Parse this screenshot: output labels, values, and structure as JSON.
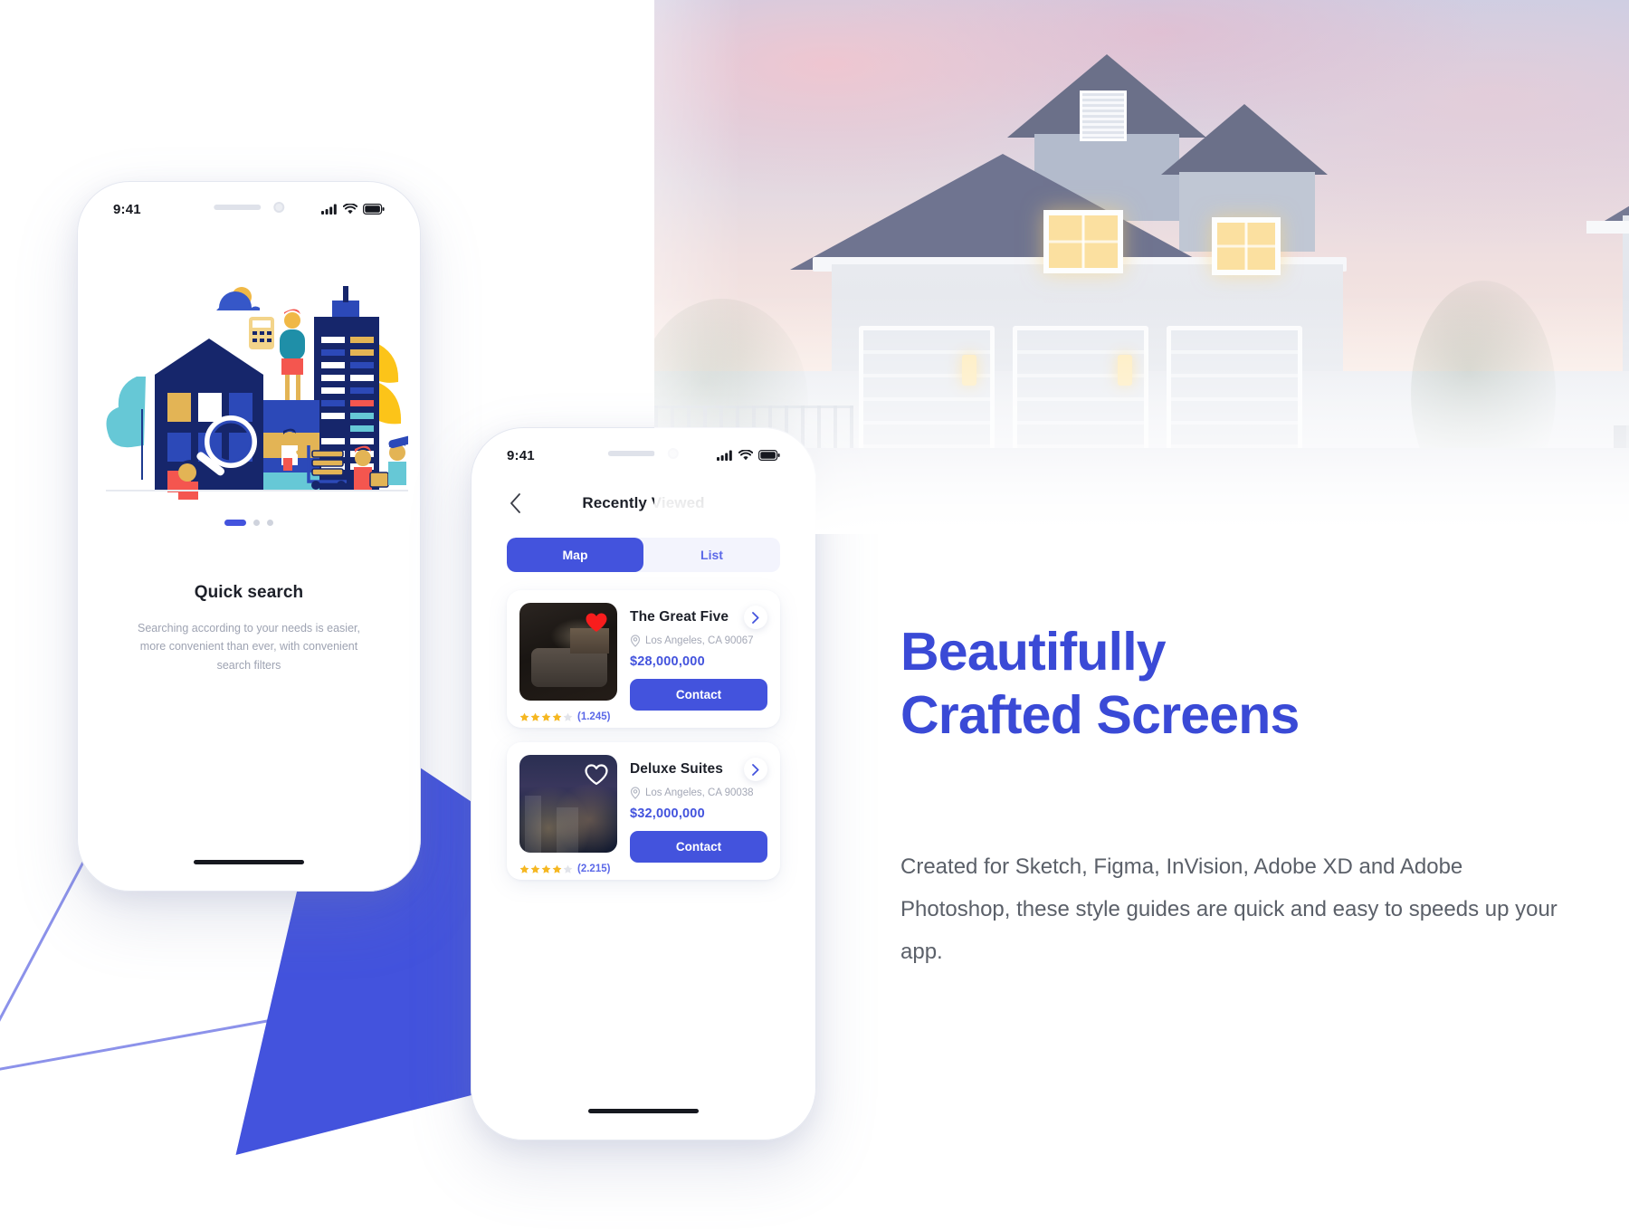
{
  "background": {
    "accent_blue": "#4353dd",
    "headline_blue": "#3a4ad6",
    "line_purple": "#8c92ea"
  },
  "phone1": {
    "status": {
      "time": "9:41",
      "signal_icon": "signal-bars-icon",
      "wifi_icon": "wifi-icon",
      "battery_icon": "battery-icon"
    },
    "illustration_name": "real-estate-search-illustration",
    "pager": {
      "dots": 3,
      "active_index": 0
    },
    "title": "Quick search",
    "description": "Searching according to your needs is easier, more convenient than ever, with convenient search filters"
  },
  "phone2": {
    "status": {
      "time": "9:41",
      "signal_icon": "signal-bars-icon",
      "wifi_icon": "wifi-icon",
      "battery_icon": "battery-icon"
    },
    "nav": {
      "back_icon": "chevron-left-icon",
      "title": "Recently Viewed"
    },
    "segments": [
      {
        "label": "Map",
        "active": true
      },
      {
        "label": "List",
        "active": false
      }
    ],
    "cards": [
      {
        "name": "The Great Five",
        "address": "Los Angeles, CA 90067",
        "price": "$28,000,000",
        "rating": 4,
        "rating_count": "(1.245)",
        "favorite": true,
        "favorite_icon": "heart-filled-icon",
        "chevron_icon": "chevron-right-icon",
        "pin_icon": "location-pin-icon",
        "button_label": "Contact",
        "thumb_name": "interior-living-room-photo"
      },
      {
        "name": "Deluxe Suites",
        "address": "Los Angeles, CA 90038",
        "price": "$32,000,000",
        "rating": 4,
        "rating_count": "(2.215)",
        "favorite": false,
        "favorite_icon": "heart-outline-icon",
        "chevron_icon": "chevron-right-icon",
        "pin_icon": "location-pin-icon",
        "button_label": "Contact",
        "thumb_name": "city-skyline-night-photo"
      }
    ]
  },
  "marketing": {
    "headline_line1": "Beautifully",
    "headline_line2": "Crafted Screens",
    "body": "Created for Sketch, Figma, InVision, Adobe XD and Adobe Photoshop, these style guides are quick and easy to speeds up your app."
  },
  "hero_photo": {
    "name": "suburban-house-at-dusk-photo"
  }
}
